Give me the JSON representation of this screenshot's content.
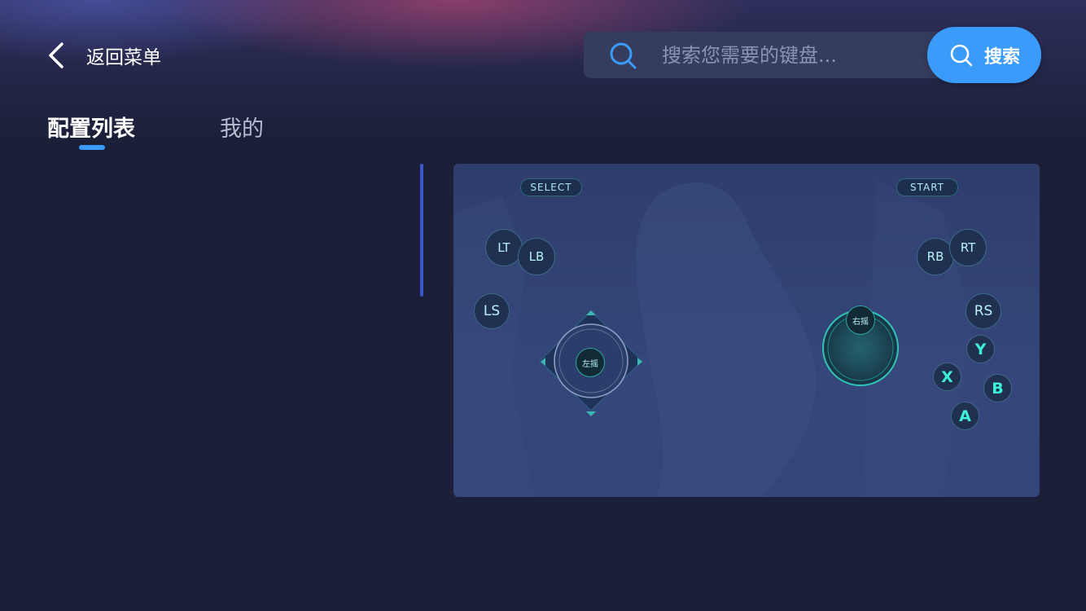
{
  "header": {
    "back_label": "返回菜单",
    "search_placeholder": "搜索您需要的键盘...",
    "search_button_label": "搜索"
  },
  "tabs": [
    {
      "label": "配置列表",
      "active": true
    },
    {
      "label": "我的",
      "active": false
    }
  ],
  "gamepad_preview": {
    "select_label": "SELECT",
    "start_label": "START",
    "lt_label": "LT",
    "lb_label": "LB",
    "rb_label": "RB",
    "rt_label": "RT",
    "ls_label": "LS",
    "rs_label": "RS",
    "left_stick_label": "左摇",
    "right_stick_label": "右摇",
    "y_label": "Y",
    "x_label": "X",
    "b_label": "B",
    "a_label": "A"
  },
  "colors": {
    "background": "#1c1f38",
    "accent": "#3a9bfa",
    "face_button_text": "#3ef0da"
  }
}
